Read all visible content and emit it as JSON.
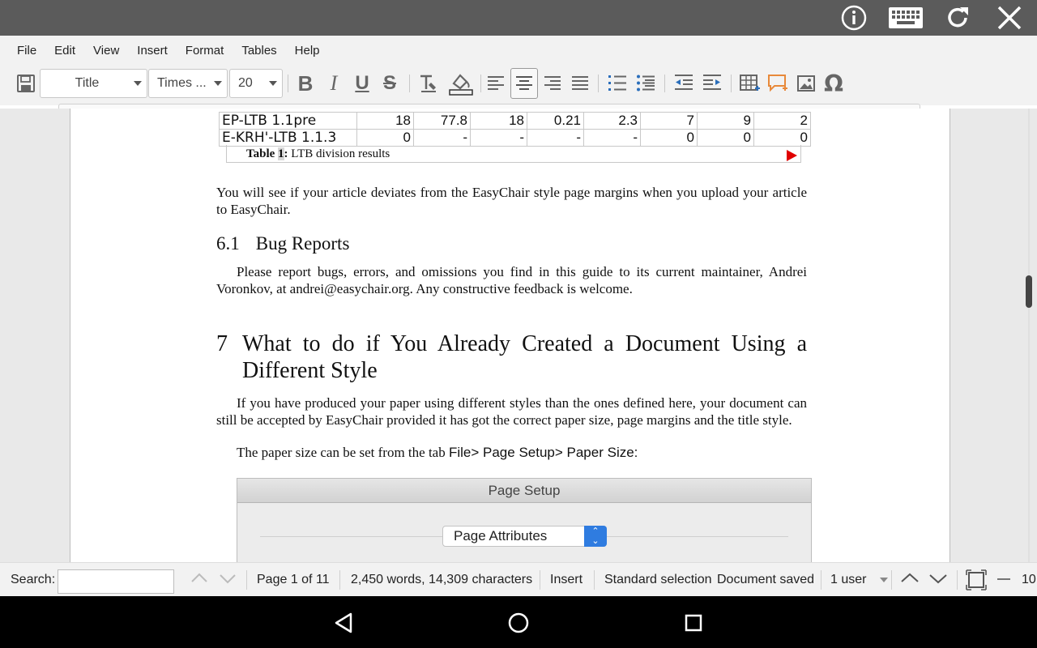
{
  "topbar": {
    "icons": [
      "info-icon",
      "keyboard-icon",
      "refresh-icon",
      "close-icon"
    ]
  },
  "menu": {
    "items": [
      "File",
      "Edit",
      "View",
      "Insert",
      "Format",
      "Tables",
      "Help"
    ]
  },
  "toolbar": {
    "style_select": "Title",
    "font_select": "Times ...",
    "size_select": "20",
    "buttons": [
      "save",
      "bold",
      "italic",
      "underline",
      "strikethrough",
      "clear-formatting",
      "highlight",
      "align-left",
      "align-center",
      "align-right",
      "justify",
      "numbered-list",
      "bulleted-list",
      "decrease-indent",
      "increase-indent",
      "insert-table",
      "insert-comment",
      "insert-image",
      "special-character"
    ]
  },
  "document": {
    "table": {
      "rows": [
        [
          "EP-LTB 1.1pre",
          "18",
          "77.8",
          "18",
          "0.21",
          "2.3",
          "7",
          "9",
          "2"
        ],
        [
          "E-KRH'-LTB 1.1.3",
          "0",
          "-",
          "-",
          "-",
          "-",
          "0",
          "0",
          "0"
        ]
      ],
      "caption_label": "Table",
      "caption_number": "1",
      "caption_colon": ":",
      "caption_text": " LTB division results"
    },
    "para1": "You will see if your article deviates from the EasyChair style page margins when you upload your article to EasyChair.",
    "section_6_1": {
      "number": "6.1",
      "title": "Bug Reports"
    },
    "para2": "Please report bugs, errors, and omissions you find in this guide to its current maintainer, Andrei Voronkov, at andrei@easychair.org. Any constructive feedback is welcome.",
    "section_7": {
      "number": "7",
      "title": "What to do if You Already Created a Document Using a Different Style"
    },
    "para3": "If you have produced your paper using different styles than the ones defined here, your document can still be accepted by EasyChair provided it has got the correct paper size, page margins and the title style.",
    "para4_prefix": "The paper size can be set from the tab ",
    "para4_path": "File> Page Setup> Paper Size:",
    "dialog": {
      "title": "Page Setup",
      "select_value": "Page Attributes"
    }
  },
  "statusbar": {
    "search_label": "Search:",
    "search_value": "",
    "page": "Page 1 of 11",
    "counts": "2,450 words, 14,309 characters",
    "mode": "Insert",
    "selection": "Standard selection",
    "save_state": "Document saved",
    "users": "1 user",
    "zoom": "10"
  },
  "navbar": {
    "icons": [
      "back-icon",
      "home-icon",
      "recents-icon"
    ]
  }
}
